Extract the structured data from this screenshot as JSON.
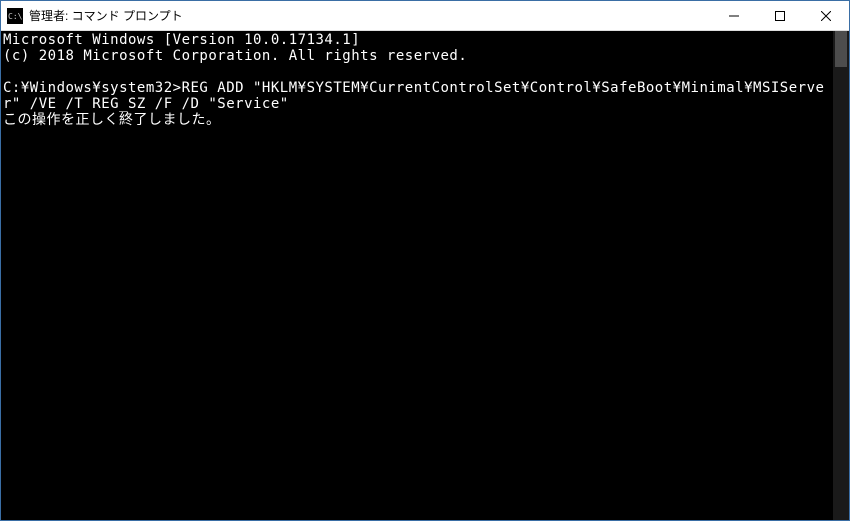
{
  "titlebar": {
    "title": "管理者: コマンド プロンプト",
    "icon_text": "C:\\"
  },
  "console": {
    "line1": "Microsoft Windows [Version 10.0.17134.1]",
    "line2": "(c) 2018 Microsoft Corporation. All rights reserved.",
    "blank1": "",
    "line3": "C:¥Windows¥system32>REG ADD \"HKLM¥SYSTEM¥CurrentControlSet¥Control¥SafeBoot¥Minimal¥MSIServer\" /VE /T REG_SZ /F /D \"Service\"",
    "line4": "この操作を正しく終了しました。"
  }
}
